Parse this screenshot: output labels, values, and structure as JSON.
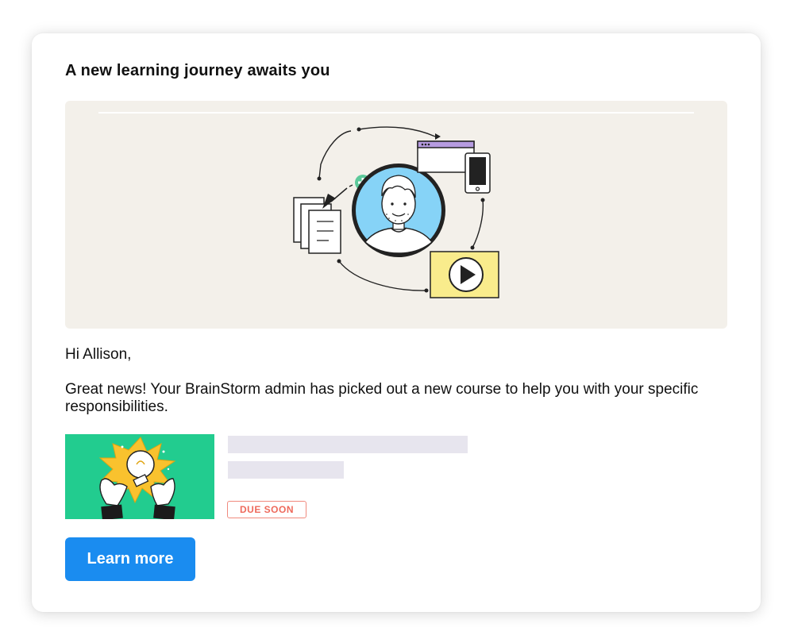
{
  "email": {
    "title": "A new learning journey awaits you",
    "greeting": "Hi Allison,",
    "message": "Great news! Your BrainStorm admin has picked out a new course to help you with your specific responsibilities.",
    "course": {
      "badge": "DUE SOON",
      "thumbnail_icon": "lightbulb-hands-icon"
    },
    "cta_label": "Learn more"
  },
  "colors": {
    "accent_blue": "#1a8cf0",
    "hero_background": "#f3f0ea",
    "avatar_circle": "#86d3f7",
    "video_card": "#f9ec8c",
    "thumbnail_green": "#22cc8f",
    "badge_red": "#ee6a5c",
    "placeholder_gray": "#e7e5ee"
  },
  "hero_icons": [
    "user-avatar-icon",
    "documents-icon",
    "browser-window-icon",
    "smartphone-icon",
    "video-play-icon",
    "plus-icon"
  ]
}
